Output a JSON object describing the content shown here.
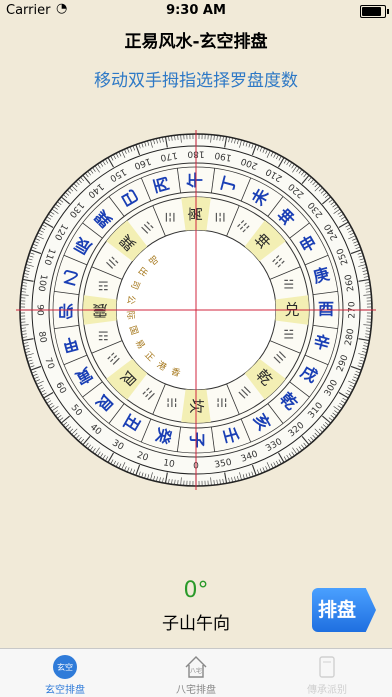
{
  "status_bar": {
    "carrier": "Carrier",
    "time": "9:30 AM"
  },
  "nav": {
    "title": "正易风水-玄空排盘"
  },
  "hint": "移动双手拇指选择罗盘度数",
  "compass": {
    "degree_ticks": [
      "0",
      "10",
      "20",
      "30",
      "40",
      "50",
      "60",
      "70",
      "80",
      "90",
      "100",
      "110",
      "120",
      "130",
      "140",
      "150",
      "160",
      "170",
      "180",
      "190",
      "200",
      "210",
      "220",
      "230",
      "240",
      "250",
      "260",
      "270",
      "280",
      "290",
      "300",
      "310",
      "320",
      "330",
      "340",
      "350"
    ],
    "mountains": [
      "子",
      "癸",
      "丑",
      "艮",
      "寅",
      "甲",
      "卯",
      "乙",
      "辰",
      "巽",
      "巳",
      "丙",
      "午",
      "丁",
      "未",
      "坤",
      "申",
      "庚",
      "酉",
      "辛",
      "戌",
      "乾",
      "亥",
      "壬"
    ],
    "trigram_labels": [
      "坎",
      "艮",
      "震",
      "巽",
      "离",
      "坤",
      "兑",
      "乾"
    ],
    "trigram_symbols": [
      "☵",
      "☶",
      "☳",
      "☴",
      "☲",
      "☷",
      "☱",
      "☰"
    ],
    "center_text": "香港正易国际公司出品",
    "colors": {
      "mountain_text": "#1a3fb5",
      "ring_band": "#f3efb4",
      "crosshair": "#d0243c"
    }
  },
  "reading": {
    "degree": "0°",
    "direction": "子山午向"
  },
  "buttons": {
    "chart": "排盘"
  },
  "tabs": [
    {
      "label": "玄空排盘",
      "icon": "玄空"
    },
    {
      "label": "八宅排盘",
      "icon": "八宅"
    },
    {
      "label": "傳承派别",
      "icon": ""
    }
  ]
}
